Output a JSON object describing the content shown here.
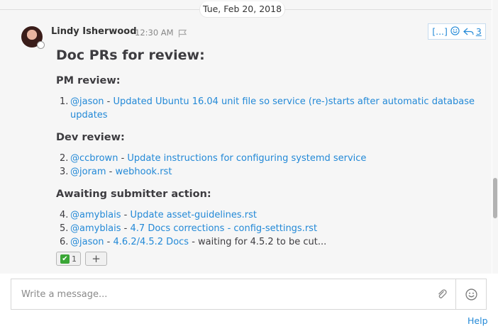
{
  "date_separator": "Tue, Feb 20, 2018",
  "post": {
    "author": "Lindy Isherwood",
    "time": "12:30 AM",
    "actions": {
      "more_label": "[...]",
      "reply_count": "3"
    },
    "title": "Doc PRs for review:",
    "sections": [
      {
        "heading": "PM review:",
        "items": [
          {
            "num": "1.",
            "user": "@jason",
            "sep": " - ",
            "link": "Updated Ubuntu 16.04 unit file so service (re-)starts after automatic database",
            "link2": "updates",
            "rest": ""
          }
        ]
      },
      {
        "heading": "Dev review:",
        "items": [
          {
            "num": "2.",
            "user": "@ccbrown",
            "sep": " - ",
            "link": "Update instructions for configuring systemd service",
            "rest": ""
          },
          {
            "num": "3.",
            "user": "@joram",
            "sep": " - ",
            "link": "webhook.rst",
            "rest": ""
          }
        ]
      },
      {
        "heading": "Awaiting submitter action:",
        "items": [
          {
            "num": "4.",
            "user": "@amyblais",
            "sep": " - ",
            "link": "Update asset-guidelines.rst",
            "rest": ""
          },
          {
            "num": "5.",
            "user": "@amyblais",
            "sep": " - ",
            "link": "4.7 Docs corrections - config-settings.rst",
            "rest": ""
          },
          {
            "num": "6.",
            "user": "@jason",
            "sep": " - ",
            "link": "4.6.2/4.5.2 Docs",
            "rest": " - waiting for 4.5.2 to be cut..."
          }
        ]
      }
    ],
    "reactions": [
      {
        "emoji": "white-check-mark",
        "count": "1"
      }
    ],
    "add_reaction_label": "+"
  },
  "composer": {
    "placeholder": "Write a message..."
  },
  "footer": {
    "help": "Help"
  },
  "colors": {
    "link": "#2389d7",
    "text": "#3d3c40",
    "feed_bg": "#f6f6f6",
    "reaction_check": "#3aa636"
  }
}
